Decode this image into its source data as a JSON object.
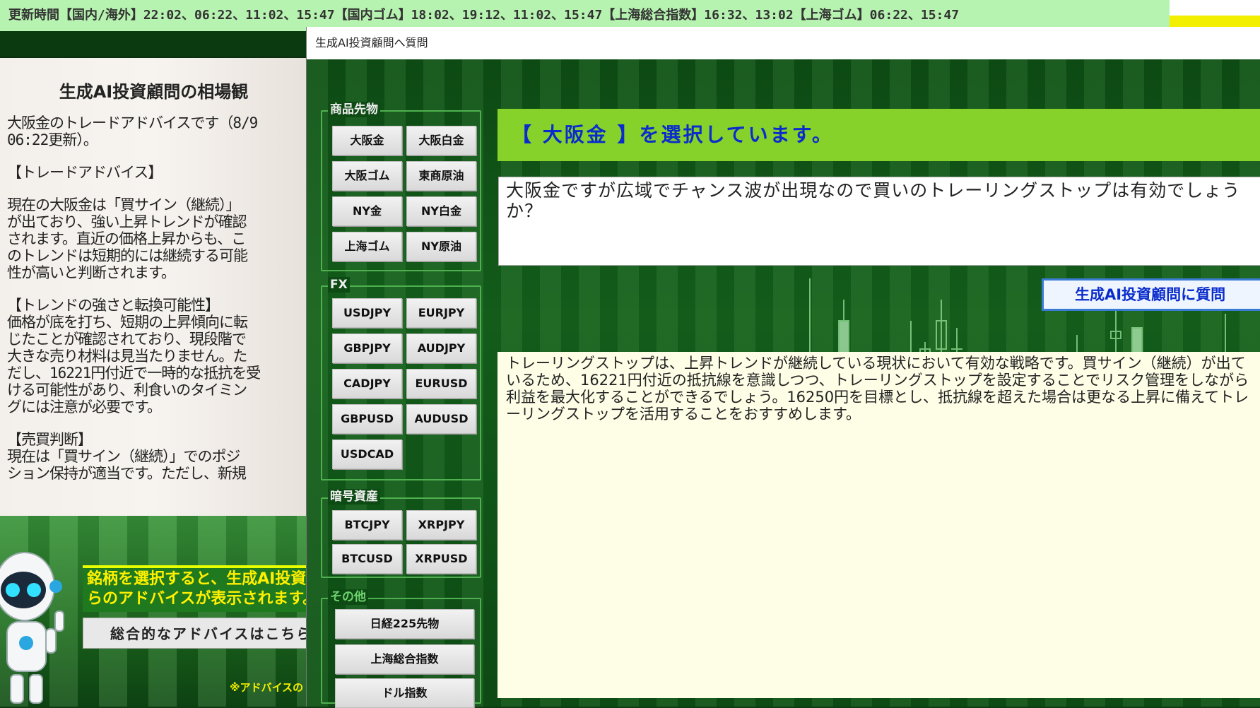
{
  "ticker": {
    "text": "更新時間【国内/海外】22:02、06:22、11:02、15:47【国内ゴム】18:02、19:12、11:02、15:47【上海総合指数】16:32、13:02【上海ゴム】06:22、15:47"
  },
  "left_panel": {
    "title": "生成AI投資顧問の相場観",
    "paragraphs": [
      "大阪金のトレードアドバイスです（8/9\n06:22更新）。",
      "【トレードアドバイス】",
      "現在の大阪金は「買サイン（継続）」\nが出ており、強い上昇トレンドが確認\nされます。直近の価格上昇からも、こ\nのトレンドは短期的には継続する可能\n性が高いと判断されます。",
      "【トレンドの強さと転換可能性】\n価格が底を打ち、短期の上昇傾向に転\nじたことが確認されており、現段階で\n大きな売り材料は見当たりません。た\nだし、16221円付近で一時的な抵抗を受\nける可能性があり、利食いのタイミン\nグには注意が必要です。",
      "【売買判断】\n現在は「買サイン（継続）」でのポジ\nション保持が適当です。ただし、新規"
    ],
    "hint": "銘柄を選択すると、生成AI投資顧問か\nらのアドバイスが表示されます。",
    "overall_button": "総合的なアドバイスはこちら",
    "note": "※アドバイスの"
  },
  "modal": {
    "title": "生成AI投資顧問へ質問",
    "groups": {
      "commodities": {
        "title": "商品先物",
        "buttons": [
          "大阪金",
          "大阪白金",
          "大阪ゴム",
          "東商原油",
          "NY金",
          "NY白金",
          "上海ゴム",
          "NY原油"
        ]
      },
      "fx": {
        "title": "FX",
        "buttons": [
          "USDJPY",
          "EURJPY",
          "GBPJPY",
          "AUDJPY",
          "CADJPY",
          "EURUSD",
          "GBPUSD",
          "AUDUSD",
          "USDCAD"
        ]
      },
      "crypto": {
        "title": "暗号資産",
        "buttons": [
          "BTCJPY",
          "XRPJPY",
          "BTCUSD",
          "XRPUSD"
        ]
      },
      "other": {
        "title": "その他",
        "buttons": [
          "日経225先物",
          "上海総合指数",
          "ドル指数"
        ]
      }
    },
    "selected_banner": "【 大阪金 】を選択しています。",
    "question": "大阪金ですが広域でチャンス波が出現なので買いのトレーリングストップは有効でしょうか？",
    "ask_button": "生成AI投資顧問に質問",
    "answer": "トレーリングストップは、上昇トレンドが継続している現状において有効な戦略です。買サイン（継続）が出ているため、16221円付近の抵抗線を意識しつつ、トレーリングストップを設定することでリスク管理をしながら利益を最大化することができるでしょう。16250円を目標とし、抵抗線を超えた場合は更なる上昇に備えてトレーリングストップを活用することをおすすめします。"
  },
  "colors": {
    "ticker_bg": "#b7f3b0",
    "banner_bg": "#86d22a",
    "banner_text": "#0a2ccc",
    "hint_text": "#fff000"
  }
}
